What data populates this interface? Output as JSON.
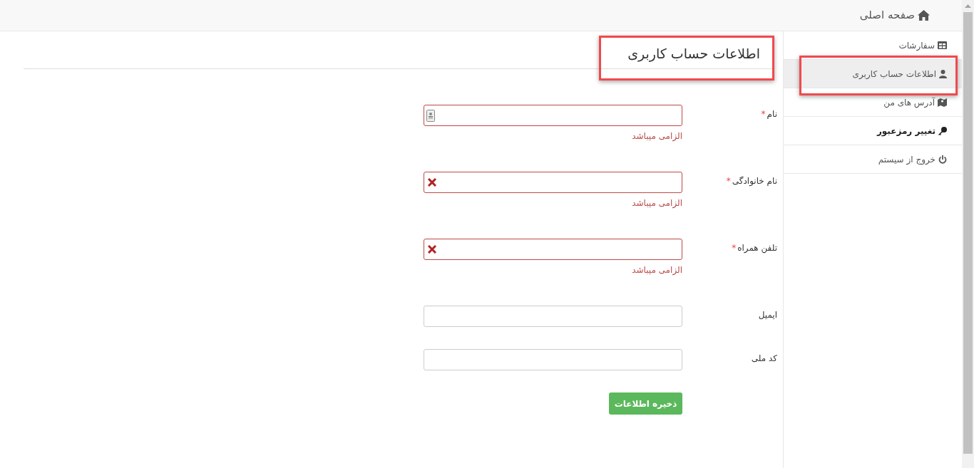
{
  "header": {
    "home_link": "صفحه اصلی"
  },
  "sidebar": {
    "items": [
      {
        "label": "سفارشات",
        "selected": false,
        "bold": false
      },
      {
        "label": "اطلاعات حساب کاربری",
        "selected": true,
        "bold": false
      },
      {
        "label": "آدرس های من",
        "selected": false,
        "bold": false
      },
      {
        "label": "تغییر رمزعبور",
        "selected": false,
        "bold": true
      },
      {
        "label": "خروج از سیستم",
        "selected": false,
        "bold": false
      }
    ]
  },
  "page_title": "اطلاعات حساب کاربری",
  "form": {
    "fields": [
      {
        "label": "نام",
        "required_mark": "*",
        "invalid": true,
        "kind": "autofill",
        "error": "الزامی میباشد"
      },
      {
        "label": "نام خانوادگی",
        "required_mark": "*",
        "invalid": true,
        "kind": "text",
        "error": "الزامی میباشد"
      },
      {
        "label": "تلفن همراه",
        "required_mark": "*",
        "invalid": true,
        "kind": "text",
        "error": "الزامی میباشد"
      },
      {
        "label": "ایمیل",
        "invalid": false,
        "kind": "text"
      },
      {
        "label": "کد ملی",
        "invalid": false,
        "kind": "text"
      }
    ],
    "submit": "ذخیره اطلاعات"
  }
}
